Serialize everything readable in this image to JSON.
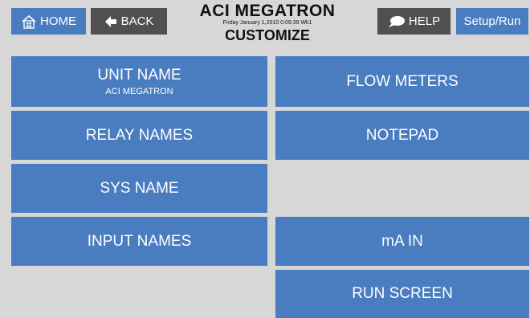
{
  "header": {
    "home_label": "HOME",
    "back_label": "BACK",
    "help_label": "HELP",
    "setup_label": "Setup/Run",
    "title": "ACI MEGATRON",
    "datetime": "Friday January 1,2010 0:09:39 Wk1",
    "page_title": "CUSTOMIZE"
  },
  "tiles": {
    "unit_name": {
      "label": "UNIT NAME",
      "value": "ACI MEGATRON"
    },
    "flow_meters": "FLOW METERS",
    "relay_names": "RELAY NAMES",
    "notepad": "NOTEPAD",
    "sys_name": "SYS NAME",
    "input_names": "INPUT NAMES",
    "ma_in": "mA IN",
    "run_screen": "RUN SCREEN"
  },
  "colors": {
    "tile_blue": "#4a7cc0",
    "header_dark": "#505050",
    "background": "#d7d7d7"
  }
}
